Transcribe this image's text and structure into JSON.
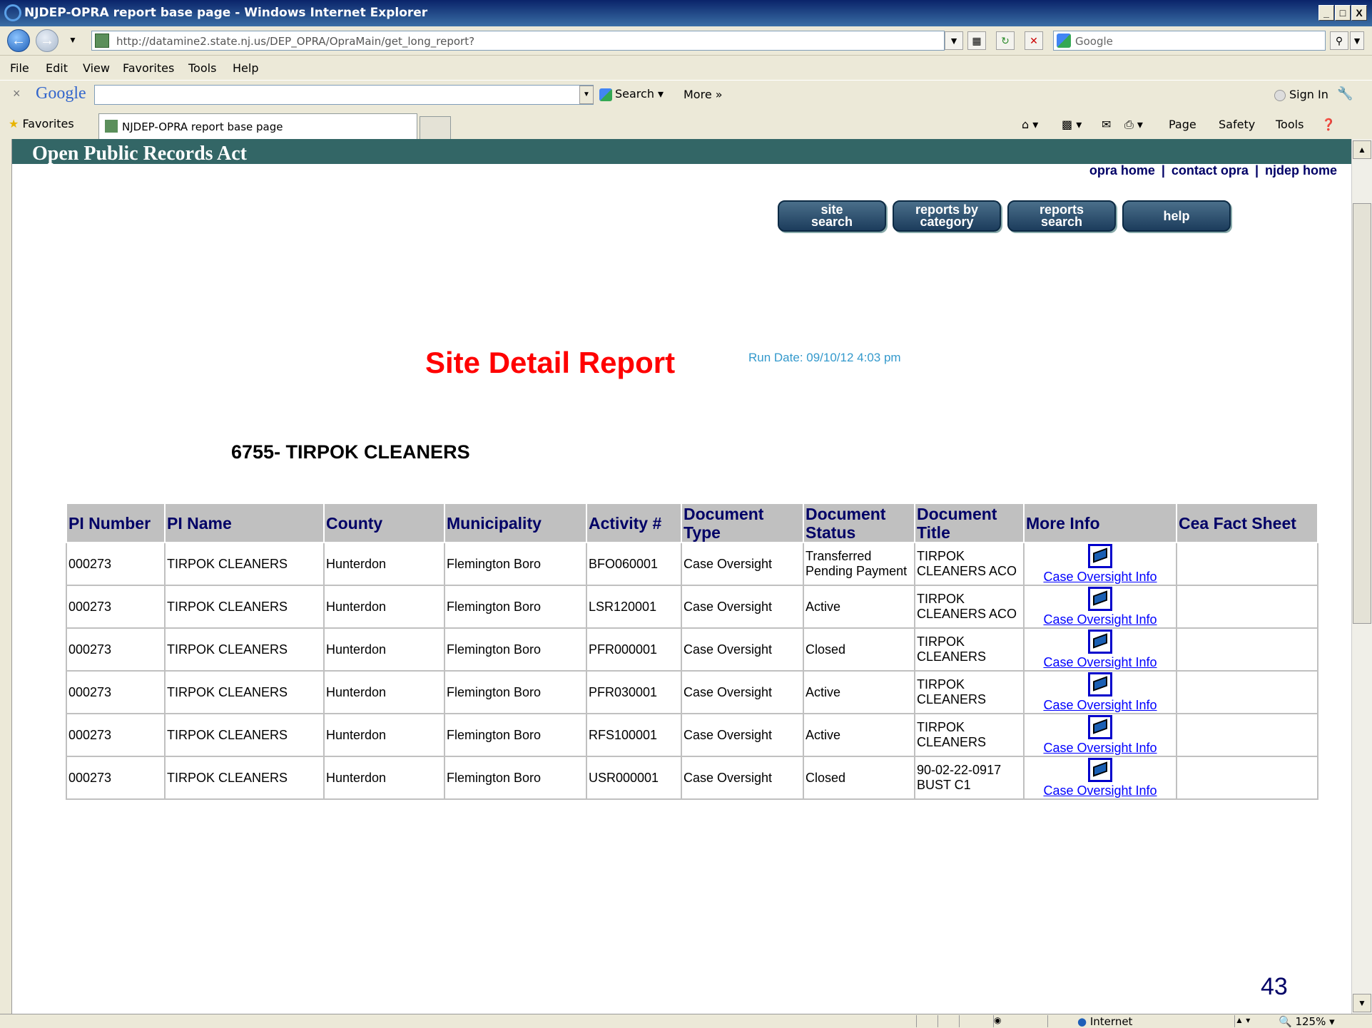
{
  "window": {
    "title": "NJDEP-OPRA report base page - Windows Internet Explorer",
    "min": "_",
    "max": "□",
    "close": "X"
  },
  "address": {
    "url": "http://datamine2.state.nj.us/DEP_OPRA/OpraMain/get_long_report?",
    "search_placeholder": "Google"
  },
  "menu": [
    "File",
    "Edit",
    "View",
    "Favorites",
    "Tools",
    "Help"
  ],
  "google_toolbar": {
    "logo": "Google",
    "search_label": "Search",
    "more_label": "More »",
    "sign_in": "Sign In"
  },
  "tabs": {
    "favorites": "Favorites",
    "active_tab": "NJDEP-OPRA report base page",
    "commands": [
      "Page",
      "Safety",
      "Tools"
    ]
  },
  "page": {
    "banner": "Open Public Records Act",
    "top_links": [
      "opra home",
      "contact opra",
      "njdep home"
    ],
    "nav_buttons": [
      {
        "line1": "site",
        "line2": "search"
      },
      {
        "line1": "reports by",
        "line2": "category"
      },
      {
        "line1": "reports",
        "line2": "search"
      },
      {
        "line1": "help",
        "line2": ""
      }
    ],
    "report_title": "Site Detail Report",
    "run_date": "Run Date: 09/10/12 4:03 pm",
    "site_name": "6755- TIRPOK CLEANERS",
    "table": {
      "headers": [
        "PI Number",
        "PI Name",
        "County",
        "Municipality",
        "Activity #",
        "Document Type",
        "Document Status",
        "Document Title",
        "More Info",
        "Cea Fact Sheet"
      ],
      "rows": [
        {
          "pi": "000273",
          "name": "TIRPOK CLEANERS",
          "county": "Hunterdon",
          "muni": "Flemington Boro",
          "activity": "BFO060001",
          "doc_type": "Case Oversight",
          "status": "Transferred Pending Payment",
          "title": "TIRPOK CLEANERS ACO",
          "more": "Case Oversight Info",
          "cea": ""
        },
        {
          "pi": "000273",
          "name": "TIRPOK CLEANERS",
          "county": "Hunterdon",
          "muni": "Flemington Boro",
          "activity": "LSR120001",
          "doc_type": "Case Oversight",
          "status": "Active",
          "title": "TIRPOK CLEANERS ACO",
          "more": "Case Oversight Info",
          "cea": ""
        },
        {
          "pi": "000273",
          "name": "TIRPOK CLEANERS",
          "county": "Hunterdon",
          "muni": "Flemington Boro",
          "activity": "PFR000001",
          "doc_type": "Case Oversight",
          "status": "Closed",
          "title": "TIRPOK CLEANERS",
          "more": "Case Oversight Info",
          "cea": ""
        },
        {
          "pi": "000273",
          "name": "TIRPOK CLEANERS",
          "county": "Hunterdon",
          "muni": "Flemington Boro",
          "activity": "PFR030001",
          "doc_type": "Case Oversight",
          "status": "Active",
          "title": "TIRPOK CLEANERS",
          "more": "Case Oversight Info",
          "cea": ""
        },
        {
          "pi": "000273",
          "name": "TIRPOK CLEANERS",
          "county": "Hunterdon",
          "muni": "Flemington Boro",
          "activity": "RFS100001",
          "doc_type": "Case Oversight",
          "status": "Active",
          "title": "TIRPOK CLEANERS",
          "more": "Case Oversight Info",
          "cea": ""
        },
        {
          "pi": "000273",
          "name": "TIRPOK CLEANERS",
          "county": "Hunterdon",
          "muni": "Flemington Boro",
          "activity": "USR000001",
          "doc_type": "Case Oversight",
          "status": "Closed",
          "title": "90-02-22-0917 BUST C1",
          "more": "Case Oversight Info",
          "cea": ""
        }
      ]
    },
    "slide_number": "43"
  },
  "status_bar": {
    "zone": "Internet",
    "zoom": "125%"
  }
}
